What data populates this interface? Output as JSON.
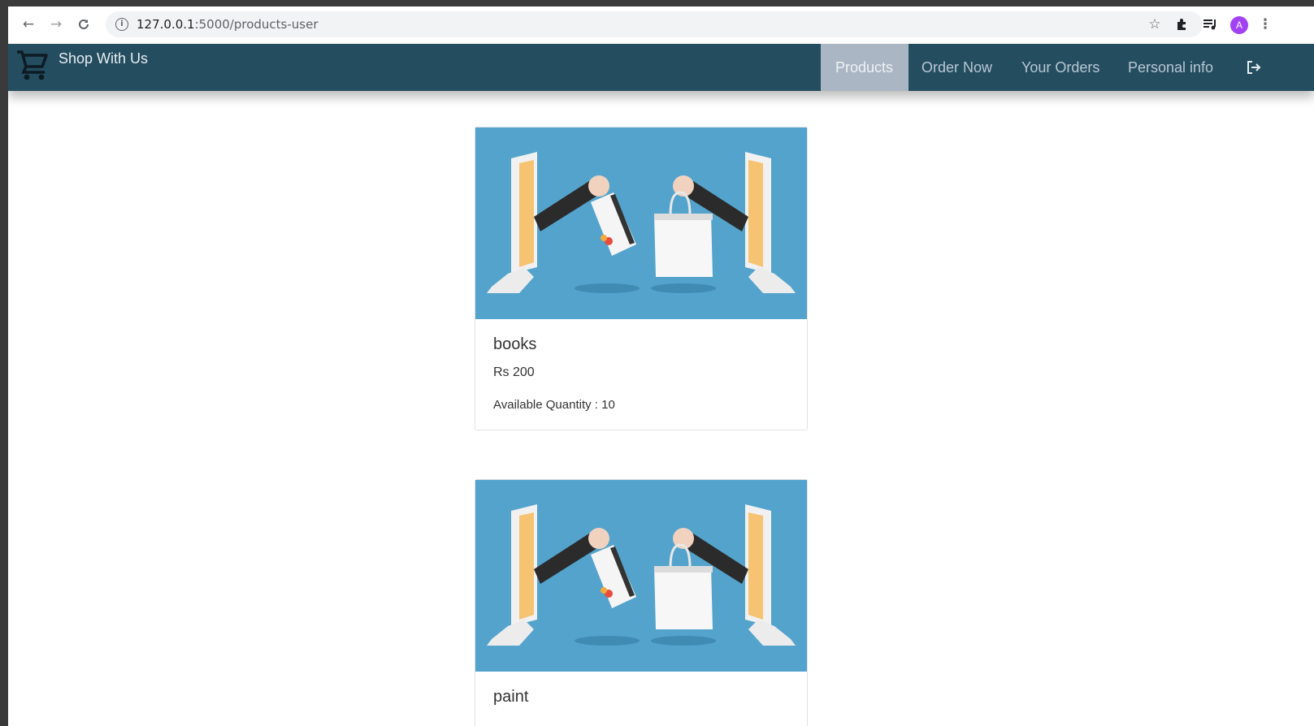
{
  "browser": {
    "url_host": "127.0.0.1",
    "url_path": ":5000/products-user",
    "avatar_letter": "A"
  },
  "navbar": {
    "brand": "Shop With Us",
    "items": [
      {
        "label": "Products",
        "active": true
      },
      {
        "label": "Order Now",
        "active": false
      },
      {
        "label": "Your Orders",
        "active": false
      },
      {
        "label": "Personal info",
        "active": false
      }
    ],
    "colors": {
      "background": "#254d60",
      "active": "#aab6c3"
    }
  },
  "products": [
    {
      "name": "books",
      "price": "Rs 200",
      "quantity": "Available Quantity : 10"
    },
    {
      "name": "paint"
    }
  ],
  "icons": [
    "back-icon",
    "forward-icon",
    "reload-icon",
    "info-icon",
    "star-icon",
    "extensions-icon",
    "media-icon",
    "menu-icon",
    "cart-icon",
    "logout-icon"
  ]
}
